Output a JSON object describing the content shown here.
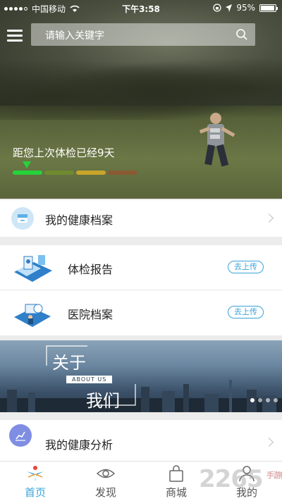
{
  "status_bar": {
    "carrier": "中国移动",
    "time": "下午3:58",
    "battery": "95%"
  },
  "header": {
    "search_placeholder": "请输入关键字"
  },
  "hero": {
    "since_text": "距您上次体检已经9天",
    "meter_colors": [
      "#26d23a",
      "#6f8a2f",
      "#c9a42a",
      "#8a5a32"
    ]
  },
  "health_file": {
    "title": "我的健康档案"
  },
  "records": [
    {
      "title": "体检报告",
      "action": "去上传"
    },
    {
      "title": "医院档案",
      "action": "去上传"
    }
  ],
  "banner": {
    "line1": "关于",
    "tag": "ABOUT US",
    "line2": "我们"
  },
  "analysis": {
    "title": "我的健康分析"
  },
  "tabs": [
    {
      "label": "首页",
      "icon": "home-logo-icon",
      "active": true
    },
    {
      "label": "发现",
      "icon": "eye-icon",
      "active": false
    },
    {
      "label": "商城",
      "icon": "shopping-bag-icon",
      "active": false
    },
    {
      "label": "我的",
      "icon": "user-icon",
      "active": false
    }
  ],
  "watermark": {
    "text": "2265",
    "sub": "手游网"
  },
  "colors": {
    "accent": "#3aa3d8",
    "meter_marker": "#26d23a"
  }
}
